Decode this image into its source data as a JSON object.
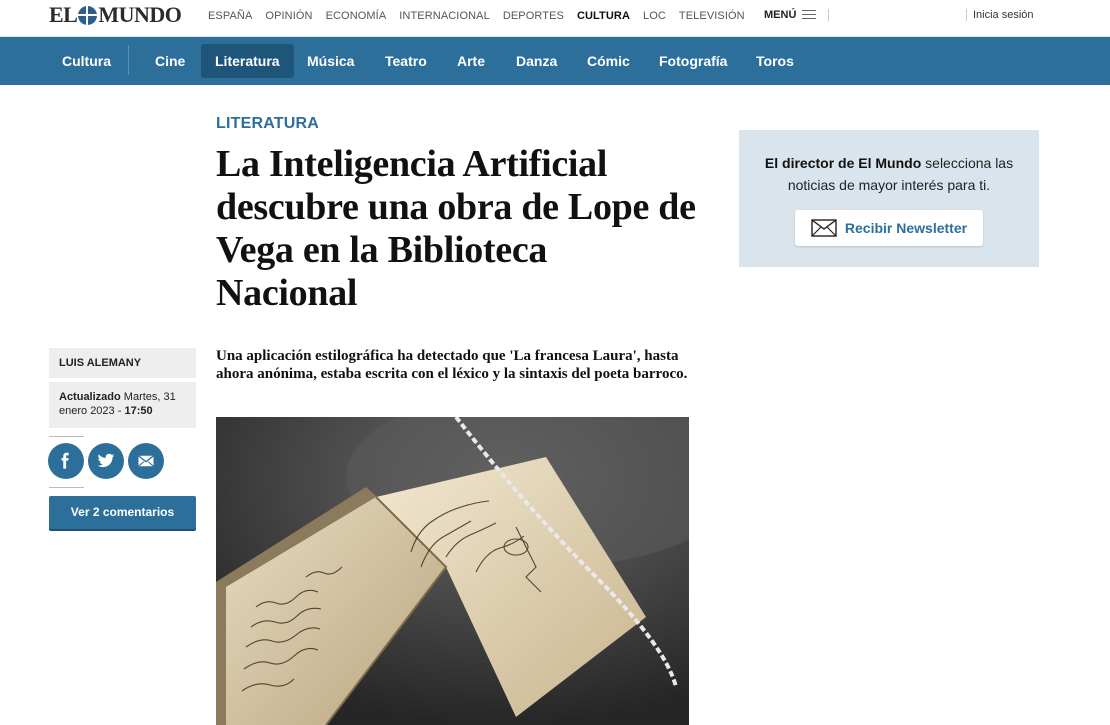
{
  "brand": {
    "logo_left": "EL",
    "logo_right": "MUNDO"
  },
  "topnav": {
    "items": [
      "ESPAÑA",
      "OPINIÓN",
      "ECONOMÍA",
      "INTERNACIONAL",
      "DEPORTES",
      "CULTURA",
      "LOC",
      "TELEVISIÓN"
    ],
    "active": "CULTURA",
    "menu_label": "MENÚ",
    "login_label": "Inicia sesión"
  },
  "section_nav": {
    "section": "Cultura",
    "items": [
      "Cine",
      "Literatura",
      "Música",
      "Teatro",
      "Arte",
      "Danza",
      "Cómic",
      "Fotografía",
      "Toros"
    ],
    "active": "Literatura"
  },
  "article": {
    "kicker": "LITERATURA",
    "headline": "La Inteligencia Artificial descubre una obra de Lope de Vega en la Biblioteca Nacional",
    "standfirst": "Una aplicación estilográfica ha detectado que 'La francesa Laura', hasta ahora anónima, estaba escrita con el léxico y la sintaxis del poeta barroco.",
    "author": "LUIS ALEMANY",
    "updated_label": "Actualizado",
    "updated_date": "Martes, 31 enero 2023 -",
    "updated_time": "17:50",
    "comments_button": "Ver 2 comentarios"
  },
  "share": {
    "icons": [
      "facebook-icon",
      "twitter-icon",
      "email-icon"
    ]
  },
  "newsletter": {
    "text_bold": "El director de El Mundo",
    "text_rest": "selecciona las noticias de mayor interés para ti.",
    "button_label": "Recibir Newsletter"
  },
  "colors": {
    "brand_blue": "#2d6f9b",
    "nav_active": "#20557a",
    "newsletter_bg": "#d9e4ec"
  }
}
